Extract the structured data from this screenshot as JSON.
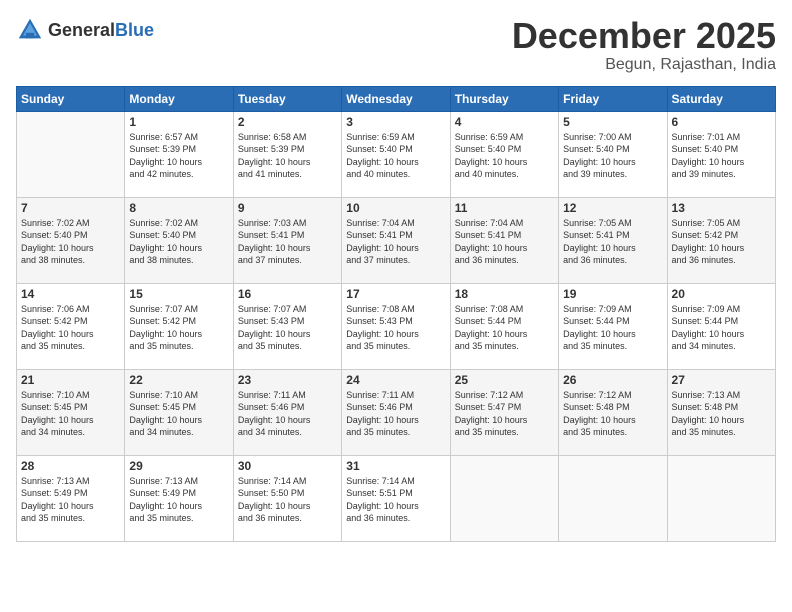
{
  "logo": {
    "text_general": "General",
    "text_blue": "Blue"
  },
  "calendar": {
    "title": "December 2025",
    "subtitle": "Begun, Rajasthan, India"
  },
  "weekdays": [
    "Sunday",
    "Monday",
    "Tuesday",
    "Wednesday",
    "Thursday",
    "Friday",
    "Saturday"
  ],
  "weeks": [
    [
      {
        "day": "",
        "info": ""
      },
      {
        "day": "1",
        "info": "Sunrise: 6:57 AM\nSunset: 5:39 PM\nDaylight: 10 hours\nand 42 minutes."
      },
      {
        "day": "2",
        "info": "Sunrise: 6:58 AM\nSunset: 5:39 PM\nDaylight: 10 hours\nand 41 minutes."
      },
      {
        "day": "3",
        "info": "Sunrise: 6:59 AM\nSunset: 5:40 PM\nDaylight: 10 hours\nand 40 minutes."
      },
      {
        "day": "4",
        "info": "Sunrise: 6:59 AM\nSunset: 5:40 PM\nDaylight: 10 hours\nand 40 minutes."
      },
      {
        "day": "5",
        "info": "Sunrise: 7:00 AM\nSunset: 5:40 PM\nDaylight: 10 hours\nand 39 minutes."
      },
      {
        "day": "6",
        "info": "Sunrise: 7:01 AM\nSunset: 5:40 PM\nDaylight: 10 hours\nand 39 minutes."
      }
    ],
    [
      {
        "day": "7",
        "info": "Sunrise: 7:02 AM\nSunset: 5:40 PM\nDaylight: 10 hours\nand 38 minutes."
      },
      {
        "day": "8",
        "info": "Sunrise: 7:02 AM\nSunset: 5:40 PM\nDaylight: 10 hours\nand 38 minutes."
      },
      {
        "day": "9",
        "info": "Sunrise: 7:03 AM\nSunset: 5:41 PM\nDaylight: 10 hours\nand 37 minutes."
      },
      {
        "day": "10",
        "info": "Sunrise: 7:04 AM\nSunset: 5:41 PM\nDaylight: 10 hours\nand 37 minutes."
      },
      {
        "day": "11",
        "info": "Sunrise: 7:04 AM\nSunset: 5:41 PM\nDaylight: 10 hours\nand 36 minutes."
      },
      {
        "day": "12",
        "info": "Sunrise: 7:05 AM\nSunset: 5:41 PM\nDaylight: 10 hours\nand 36 minutes."
      },
      {
        "day": "13",
        "info": "Sunrise: 7:05 AM\nSunset: 5:42 PM\nDaylight: 10 hours\nand 36 minutes."
      }
    ],
    [
      {
        "day": "14",
        "info": "Sunrise: 7:06 AM\nSunset: 5:42 PM\nDaylight: 10 hours\nand 35 minutes."
      },
      {
        "day": "15",
        "info": "Sunrise: 7:07 AM\nSunset: 5:42 PM\nDaylight: 10 hours\nand 35 minutes."
      },
      {
        "day": "16",
        "info": "Sunrise: 7:07 AM\nSunset: 5:43 PM\nDaylight: 10 hours\nand 35 minutes."
      },
      {
        "day": "17",
        "info": "Sunrise: 7:08 AM\nSunset: 5:43 PM\nDaylight: 10 hours\nand 35 minutes."
      },
      {
        "day": "18",
        "info": "Sunrise: 7:08 AM\nSunset: 5:44 PM\nDaylight: 10 hours\nand 35 minutes."
      },
      {
        "day": "19",
        "info": "Sunrise: 7:09 AM\nSunset: 5:44 PM\nDaylight: 10 hours\nand 35 minutes."
      },
      {
        "day": "20",
        "info": "Sunrise: 7:09 AM\nSunset: 5:44 PM\nDaylight: 10 hours\nand 34 minutes."
      }
    ],
    [
      {
        "day": "21",
        "info": "Sunrise: 7:10 AM\nSunset: 5:45 PM\nDaylight: 10 hours\nand 34 minutes."
      },
      {
        "day": "22",
        "info": "Sunrise: 7:10 AM\nSunset: 5:45 PM\nDaylight: 10 hours\nand 34 minutes."
      },
      {
        "day": "23",
        "info": "Sunrise: 7:11 AM\nSunset: 5:46 PM\nDaylight: 10 hours\nand 34 minutes."
      },
      {
        "day": "24",
        "info": "Sunrise: 7:11 AM\nSunset: 5:46 PM\nDaylight: 10 hours\nand 35 minutes."
      },
      {
        "day": "25",
        "info": "Sunrise: 7:12 AM\nSunset: 5:47 PM\nDaylight: 10 hours\nand 35 minutes."
      },
      {
        "day": "26",
        "info": "Sunrise: 7:12 AM\nSunset: 5:48 PM\nDaylight: 10 hours\nand 35 minutes."
      },
      {
        "day": "27",
        "info": "Sunrise: 7:13 AM\nSunset: 5:48 PM\nDaylight: 10 hours\nand 35 minutes."
      }
    ],
    [
      {
        "day": "28",
        "info": "Sunrise: 7:13 AM\nSunset: 5:49 PM\nDaylight: 10 hours\nand 35 minutes."
      },
      {
        "day": "29",
        "info": "Sunrise: 7:13 AM\nSunset: 5:49 PM\nDaylight: 10 hours\nand 35 minutes."
      },
      {
        "day": "30",
        "info": "Sunrise: 7:14 AM\nSunset: 5:50 PM\nDaylight: 10 hours\nand 36 minutes."
      },
      {
        "day": "31",
        "info": "Sunrise: 7:14 AM\nSunset: 5:51 PM\nDaylight: 10 hours\nand 36 minutes."
      },
      {
        "day": "",
        "info": ""
      },
      {
        "day": "",
        "info": ""
      },
      {
        "day": "",
        "info": ""
      }
    ]
  ]
}
